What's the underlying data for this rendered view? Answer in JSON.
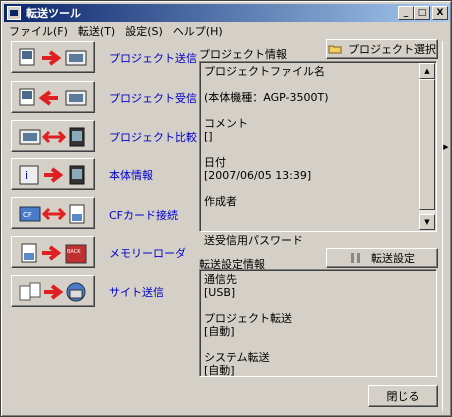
{
  "window": {
    "title": "転送ツール",
    "controls": [
      "_",
      "□",
      "X"
    ]
  },
  "menu": [
    "ファイル(F)",
    "転送(T)",
    "設定(S)",
    "ヘルプ(H)"
  ],
  "functions": [
    {
      "label": "プロジェクト送信",
      "arrow": "→"
    },
    {
      "label": "プロジェクト受信",
      "arrow": "←"
    },
    {
      "label": "プロジェクト比較",
      "arrow": "⇔"
    },
    {
      "label": "本体情報",
      "arrow": "→"
    },
    {
      "label": "CFカード接続",
      "arrow": "⇔"
    },
    {
      "label": "メモリーローダ",
      "arrow": "→"
    },
    {
      "label": "サイト送信",
      "arrow": "→"
    }
  ],
  "project_info": {
    "label": "プロジェクト情報",
    "select_button": "プロジェクト選択",
    "lines": [
      "プロジェクトファイル名",
      "",
      "(本体機種：AGP-3500T)",
      "",
      "コメント",
      "[]",
      "",
      "日付",
      "[2007/06/05 13:39]",
      "",
      "作成者",
      "",
      "",
      "送受信用パスワード"
    ]
  },
  "transfer_settings": {
    "label": "転送設定情報",
    "settings_button": "転送設定",
    "lines": [
      "通信先",
      "[USB]",
      "",
      "プロジェクト転送",
      "[自動]",
      "",
      "システム転送",
      "[自動]"
    ]
  },
  "close_button": "閉じる",
  "colors": {
    "title_start": "#0a246a",
    "title_end": "#a6caf0",
    "label_blue": "#0000cc",
    "arrow_red": "#e02020",
    "face": "#d4d0c8"
  }
}
